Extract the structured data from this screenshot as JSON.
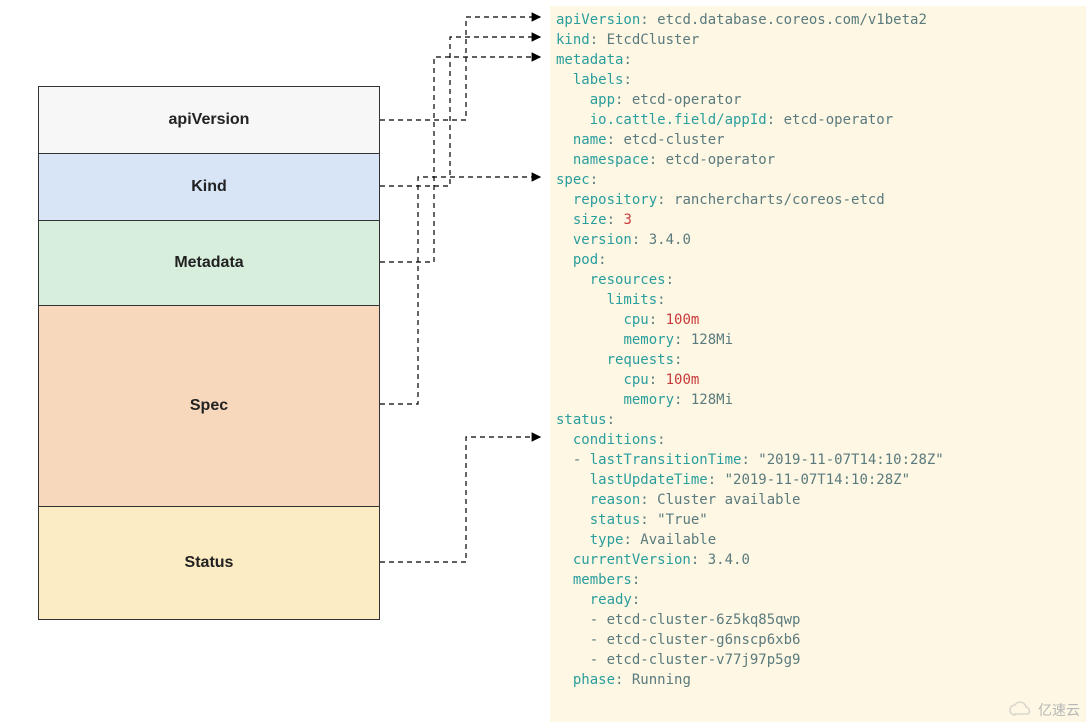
{
  "boxes": {
    "apiVersion": "apiVersion",
    "kind": "Kind",
    "metadata": "Metadata",
    "spec": "Spec",
    "status": "Status"
  },
  "yaml": {
    "apiVersion": {
      "k": "apiVersion",
      "v": "etcd.database.coreos.com/v1beta2"
    },
    "kind": {
      "k": "kind",
      "v": "EtcdCluster"
    },
    "metadata": {
      "k": "metadata",
      "labels_k": "labels",
      "app": {
        "k": "app",
        "v": "etcd-operator"
      },
      "appId": {
        "k": "io.cattle.field/appId",
        "v": "etcd-operator"
      },
      "name": {
        "k": "name",
        "v": "etcd-cluster"
      },
      "namespace": {
        "k": "namespace",
        "v": "etcd-operator"
      }
    },
    "spec": {
      "k": "spec",
      "repository": {
        "k": "repository",
        "v": "ranchercharts/coreos-etcd"
      },
      "size": {
        "k": "size",
        "v": "3"
      },
      "version": {
        "k": "version",
        "v": "3.4.0"
      },
      "pod_k": "pod",
      "resources_k": "resources",
      "limits_k": "limits",
      "limits_cpu": {
        "k": "cpu",
        "v": "100m"
      },
      "limits_mem": {
        "k": "memory",
        "v": "128Mi"
      },
      "requests_k": "requests",
      "requests_cpu": {
        "k": "cpu",
        "v": "100m"
      },
      "requests_mem": {
        "k": "memory",
        "v": "128Mi"
      }
    },
    "status": {
      "k": "status",
      "conditions_k": "conditions",
      "lastTransitionTime": {
        "k": "lastTransitionTime",
        "v": "\"2019-11-07T14:10:28Z\""
      },
      "lastUpdateTime": {
        "k": "lastUpdateTime",
        "v": "\"2019-11-07T14:10:28Z\""
      },
      "reason": {
        "k": "reason",
        "v": "Cluster available"
      },
      "statusf": {
        "k": "status",
        "v": "\"True\""
      },
      "type": {
        "k": "type",
        "v": "Available"
      },
      "currentVersion": {
        "k": "currentVersion",
        "v": "3.4.0"
      },
      "members_k": "members",
      "ready_k": "ready",
      "members": [
        "etcd-cluster-6z5kq85qwp",
        "etcd-cluster-g6nscp6xb6",
        "etcd-cluster-v77j97p5g9"
      ],
      "phase": {
        "k": "phase",
        "v": "Running"
      }
    }
  },
  "watermark": "亿速云"
}
